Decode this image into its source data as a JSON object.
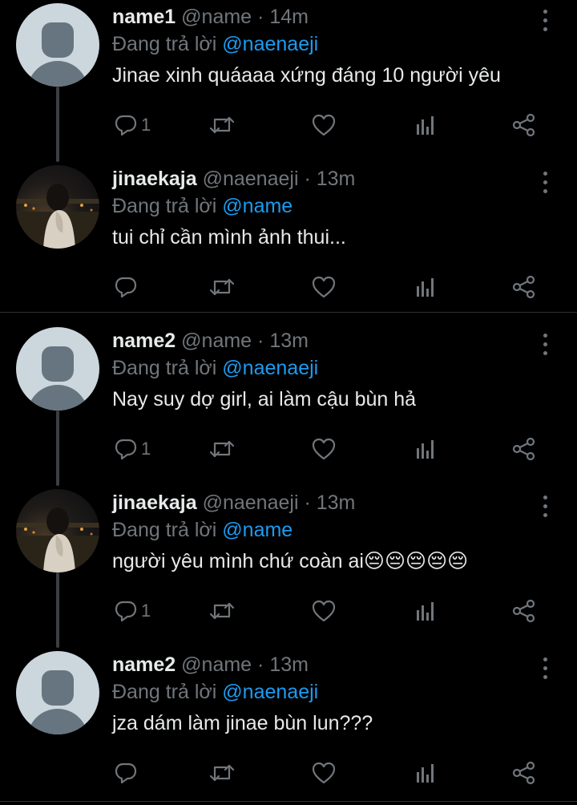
{
  "tweets": [
    {
      "name": "name1",
      "handle": "@name",
      "dot": "·",
      "time": "14m",
      "reply_prefix": "Đang trả lời",
      "reply_to": "@naenaeji",
      "text": "Jinae xinh quáaaa xứng đáng 10 người yêu",
      "reply_count": "1",
      "avatar": "default"
    },
    {
      "name": "jinaekaja",
      "handle": "@naenaeji",
      "dot": "·",
      "time": "13m",
      "reply_prefix": "Đang trả lời",
      "reply_to": "@name",
      "text": "tui chỉ cần mình ảnh thui...",
      "reply_count": "",
      "avatar": "photo"
    },
    {
      "name": "name2",
      "handle": "@name",
      "dot": "·",
      "time": "13m",
      "reply_prefix": "Đang trả lời",
      "reply_to": "@naenaeji",
      "text": "Nay suy dợ girl, ai làm cậu bùn hả",
      "reply_count": "1",
      "avatar": "default"
    },
    {
      "name": "jinaekaja",
      "handle": "@naenaeji",
      "dot": "·",
      "time": "13m",
      "reply_prefix": "Đang trả lời",
      "reply_to": "@name",
      "text": "người yêu mình chứ coàn ai😔😔😔😔😔",
      "reply_count": "1",
      "avatar": "photo"
    },
    {
      "name": "name2",
      "handle": "@name",
      "dot": "·",
      "time": "13m",
      "reply_prefix": "Đang trả lời",
      "reply_to": "@naenaeji",
      "text": "jza dám làm jinae bùn lun???",
      "reply_count": "",
      "avatar": "default"
    }
  ],
  "icons": [
    "reply-icon",
    "retweet-icon",
    "like-icon",
    "analytics-icon",
    "share-icon",
    "more-icon"
  ],
  "colors": {
    "background": "#000000",
    "text": "#e7e9ea",
    "muted": "#71767b",
    "link": "#1d9bf0"
  }
}
